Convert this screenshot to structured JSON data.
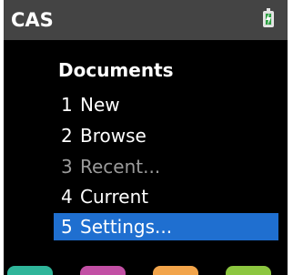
{
  "header": {
    "title": "CAS",
    "battery_icon": "battery-charging-icon"
  },
  "menu": {
    "heading": "Documents",
    "items": [
      {
        "number": "1",
        "label": "New",
        "state": "enabled"
      },
      {
        "number": "2",
        "label": "Browse",
        "state": "enabled"
      },
      {
        "number": "3",
        "label": "Recent...",
        "state": "disabled"
      },
      {
        "number": "4",
        "label": "Current",
        "state": "enabled"
      },
      {
        "number": "5",
        "label": "Settings...",
        "state": "selected"
      }
    ]
  },
  "soft_keys": {
    "colors": [
      "#2fb59a",
      "#c24fa4",
      "#f2a44a",
      "#8cc63f"
    ]
  },
  "colors": {
    "background": "#000000",
    "titlebar": "#444444",
    "selection": "#1f6fd0",
    "disabled_text": "#9a9a9a"
  }
}
